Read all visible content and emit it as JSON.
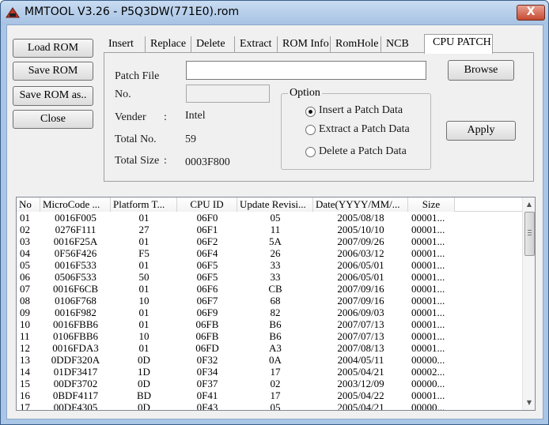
{
  "window": {
    "title": "MMTOOL V3.26 - P5Q3DW(771E0).rom",
    "close_glyph": "X"
  },
  "buttons": {
    "load_rom": "Load ROM",
    "save_rom": "Save ROM",
    "save_rom_as": "Save ROM as..",
    "close": "Close",
    "browse": "Browse",
    "apply": "Apply"
  },
  "tabs": [
    "Insert",
    "Replace",
    "Delete",
    "Extract",
    "ROM Info",
    "RomHole",
    "NCB",
    "CPU PATCH"
  ],
  "active_tab": "CPU PATCH",
  "patch": {
    "patch_file_label": "Patch File",
    "patch_file_value": "",
    "no_label": "No.",
    "no_value": "",
    "vender_label": "Vender",
    "vender_colon": ":",
    "vender_value": "Intel",
    "total_no_label": "Total No.",
    "total_no_value": "59",
    "total_size_label": "Total Size",
    "total_size_colon": ":",
    "total_size_value": "0003F800"
  },
  "option": {
    "title": "Option",
    "items": [
      {
        "label": "Insert a Patch Data",
        "checked": true
      },
      {
        "label": "Extract a Patch Data",
        "checked": false
      },
      {
        "label": "Delete a Patch Data",
        "checked": false
      }
    ]
  },
  "table": {
    "columns": [
      "No",
      "MicroCode ...",
      "Platform T...",
      "CPU ID",
      "Update Revisi...",
      "Date(YYYY/MM/...",
      "Size"
    ],
    "rows": [
      [
        "01",
        "0016F005",
        "01",
        "06F0",
        "05",
        "2005/08/18",
        "00001..."
      ],
      [
        "02",
        "0276F111",
        "27",
        "06F1",
        "11",
        "2005/10/10",
        "00001..."
      ],
      [
        "03",
        "0016F25A",
        "01",
        "06F2",
        "5A",
        "2007/09/26",
        "00001..."
      ],
      [
        "04",
        "0F56F426",
        "F5",
        "06F4",
        "26",
        "2006/03/12",
        "00001..."
      ],
      [
        "05",
        "0016F533",
        "01",
        "06F5",
        "33",
        "2006/05/01",
        "00001..."
      ],
      [
        "06",
        "0506F533",
        "50",
        "06F5",
        "33",
        "2006/05/01",
        "00001..."
      ],
      [
        "07",
        "0016F6CB",
        "01",
        "06F6",
        "CB",
        "2007/09/16",
        "00001..."
      ],
      [
        "08",
        "0106F768",
        "10",
        "06F7",
        "68",
        "2007/09/16",
        "00001..."
      ],
      [
        "09",
        "0016F982",
        "01",
        "06F9",
        "82",
        "2006/09/03",
        "00001..."
      ],
      [
        "10",
        "0016FBB6",
        "01",
        "06FB",
        "B6",
        "2007/07/13",
        "00001..."
      ],
      [
        "11",
        "0106FBB6",
        "10",
        "06FB",
        "B6",
        "2007/07/13",
        "00001..."
      ],
      [
        "12",
        "0016FDA3",
        "01",
        "06FD",
        "A3",
        "2007/08/13",
        "00001..."
      ],
      [
        "13",
        "0DDF320A",
        "0D",
        "0F32",
        "0A",
        "2004/05/11",
        "00000..."
      ],
      [
        "14",
        "01DF3417",
        "1D",
        "0F34",
        "17",
        "2005/04/21",
        "00002..."
      ],
      [
        "15",
        "00DF3702",
        "0D",
        "0F37",
        "02",
        "2003/12/09",
        "00000..."
      ],
      [
        "16",
        "0BDF4117",
        "BD",
        "0F41",
        "17",
        "2005/04/22",
        "00001..."
      ],
      [
        "17",
        "00DF4305",
        "0D",
        "0F43",
        "05",
        "2005/04/21",
        "00000..."
      ]
    ]
  },
  "icons": {
    "app": "app-logo-icon",
    "scroll_up": "scroll-up-icon",
    "scroll_down": "scroll-down-icon"
  },
  "colors": {
    "title_bar": "#a9c6e6",
    "close_button": "#c74a33",
    "face": "#f0f0f0"
  }
}
